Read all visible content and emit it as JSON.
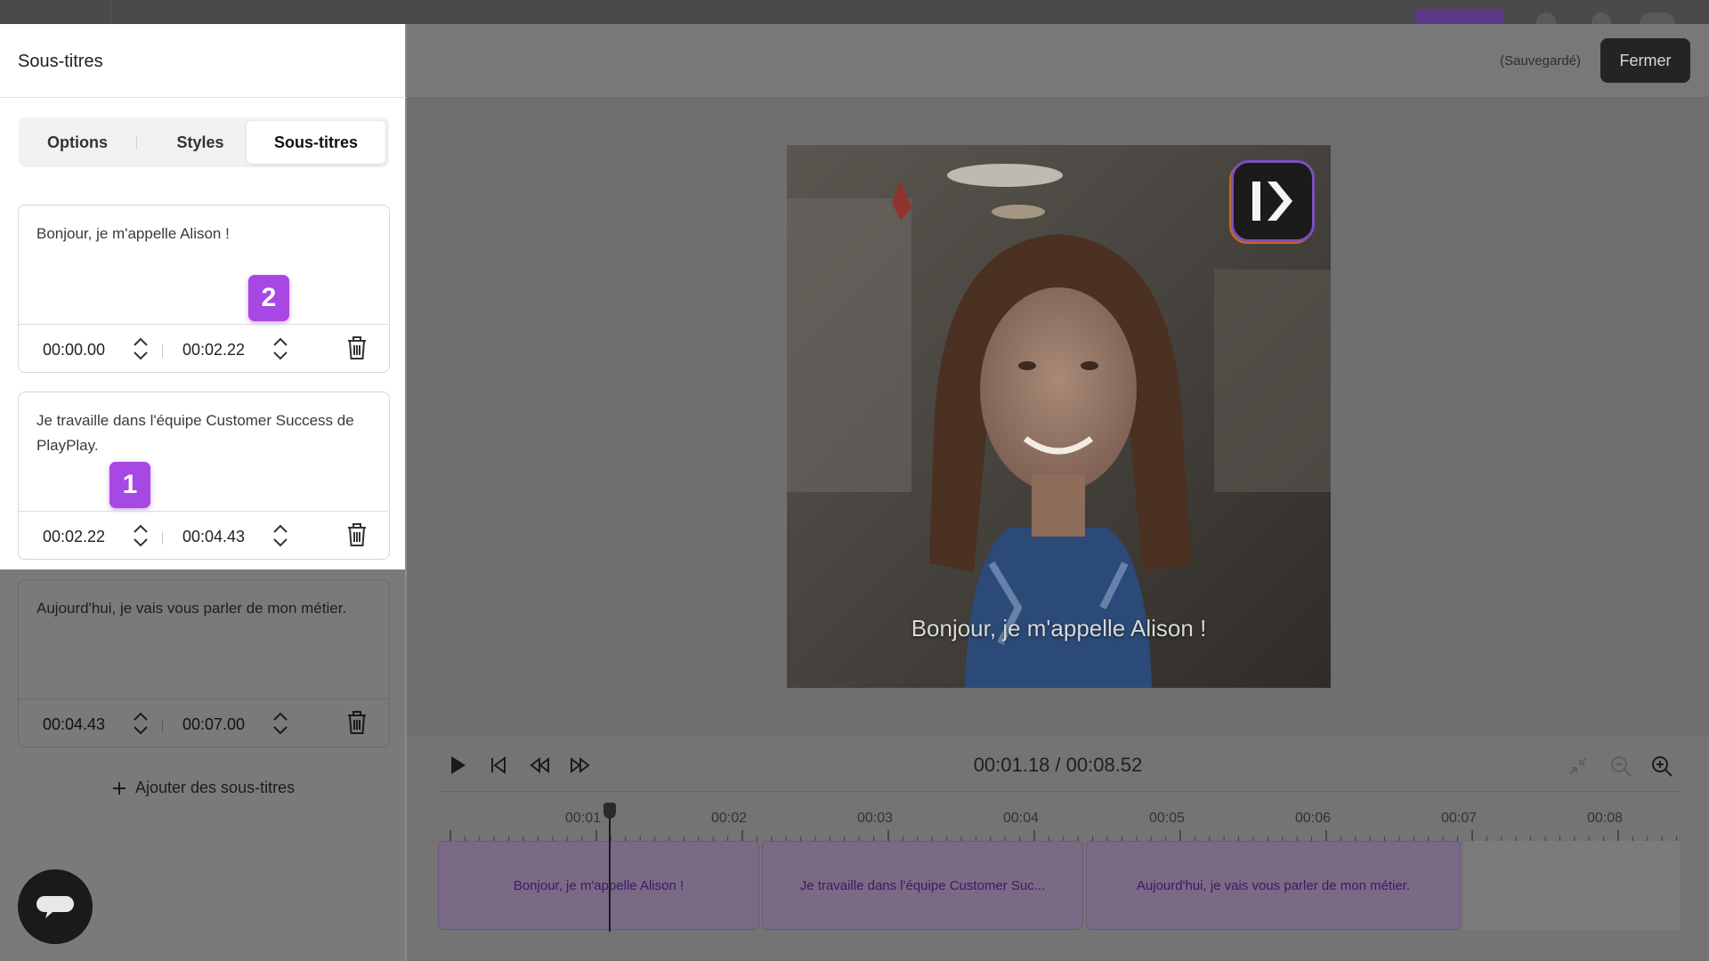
{
  "panel": {
    "title": "Sous-titres",
    "tabs": [
      {
        "label": "Options"
      },
      {
        "label": "Styles"
      },
      {
        "label": "Sous-titres",
        "active": true
      }
    ],
    "subtitles": [
      {
        "text": "Bonjour, je m'appelle Alison !",
        "start": "00:00.00",
        "end": "00:02.22",
        "badge": "2"
      },
      {
        "text": "Je travaille dans l'équipe Customer Success de PlayPlay.",
        "start": "00:02.22",
        "end": "00:04.43",
        "badge": "1"
      },
      {
        "text": "Aujourd'hui, je vais vous parler de mon métier.",
        "start": "00:04.43",
        "end": "00:07.00"
      }
    ],
    "add_label": "Ajouter des sous-titres"
  },
  "header": {
    "saved_status": "(Sauvegardé)",
    "close_label": "Fermer"
  },
  "video": {
    "caption": "Bonjour, je m'appelle Alison !"
  },
  "player": {
    "timecode": "00:01.18 / 00:08.52",
    "timeline_labels": [
      "00:01",
      "00:02",
      "00:03",
      "00:04",
      "00:05",
      "00:06",
      "00:07",
      "00:08"
    ],
    "segments": [
      {
        "label": "Bonjour, je m'appelle Alison !"
      },
      {
        "label": "Je travaille dans l'équipe Customer Suc..."
      },
      {
        "label": "Aujourd'hui, je vais vous parler de mon métier."
      }
    ]
  },
  "colors": {
    "accent_badge": "#a747e4",
    "segment_text": "#3b1a66"
  }
}
